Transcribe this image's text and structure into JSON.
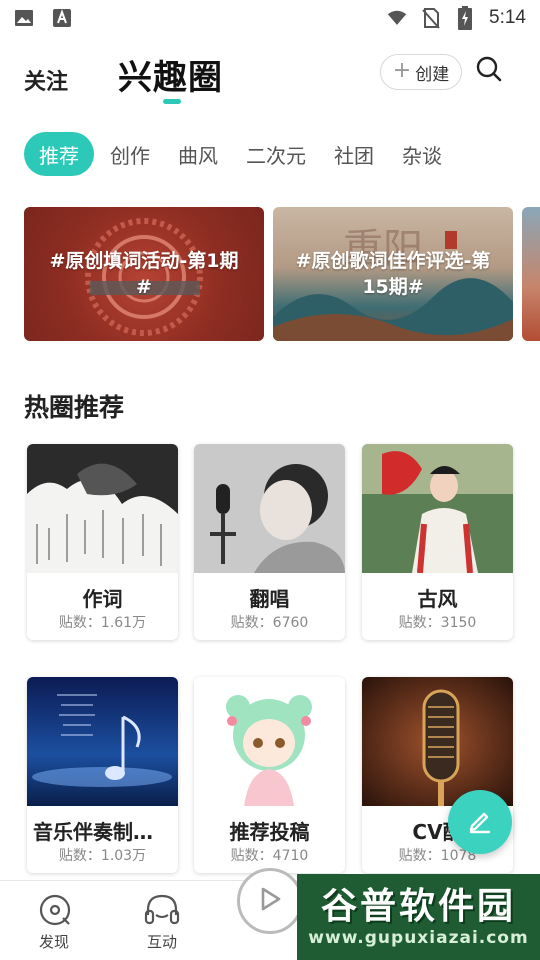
{
  "status_bar": {
    "time": "5:14",
    "left_icons": [
      "image-icon",
      "text-a-icon"
    ],
    "right_icons": [
      "wifi-icon",
      "no-sim-icon",
      "battery-charging-icon"
    ]
  },
  "header": {
    "follow_label": "关注",
    "title": "兴趣圈",
    "create_label": "创建",
    "accent_color": "#2cc9b8"
  },
  "tabs": [
    {
      "label": "推荐",
      "active": true
    },
    {
      "label": "创作",
      "active": false
    },
    {
      "label": "曲风",
      "active": false
    },
    {
      "label": "二次元",
      "active": false
    },
    {
      "label": "社团",
      "active": false
    },
    {
      "label": "杂谈",
      "active": false
    }
  ],
  "banners": [
    {
      "text": "#原创填词活动-第1期#"
    },
    {
      "text": "#原创歌词佳作评选-第15期#"
    }
  ],
  "section": {
    "title": "热圈推荐"
  },
  "circles": [
    {
      "name": "作词",
      "posts": "贴数：1.61万",
      "image": "ink-landscape-calligraphy"
    },
    {
      "name": "翻唱",
      "posts": "贴数：6760",
      "image": "boy-singing-microphone"
    },
    {
      "name": "古风",
      "posts": "贴数：3150",
      "image": "woman-hanfu-fan"
    },
    {
      "name": "音乐伴奏制作...",
      "posts": "贴数：1.03万",
      "image": "music-note-night-sea"
    },
    {
      "name": "推荐投稿",
      "posts": "贴数：4710",
      "image": "anime-girl-green-hair"
    },
    {
      "name": "CV配",
      "posts": "贴数：1078",
      "image": "vintage-microphone"
    }
  ],
  "fab": {
    "icon": "pen-icon"
  },
  "bottom_nav": [
    {
      "label": "发现",
      "icon": "disc-icon"
    },
    {
      "label": "互动",
      "icon": "headphones-icon"
    }
  ],
  "play_button": {
    "icon": "play-icon"
  },
  "watermark": {
    "title": "谷普软件园",
    "url": "www.gupuxiazai.com"
  }
}
